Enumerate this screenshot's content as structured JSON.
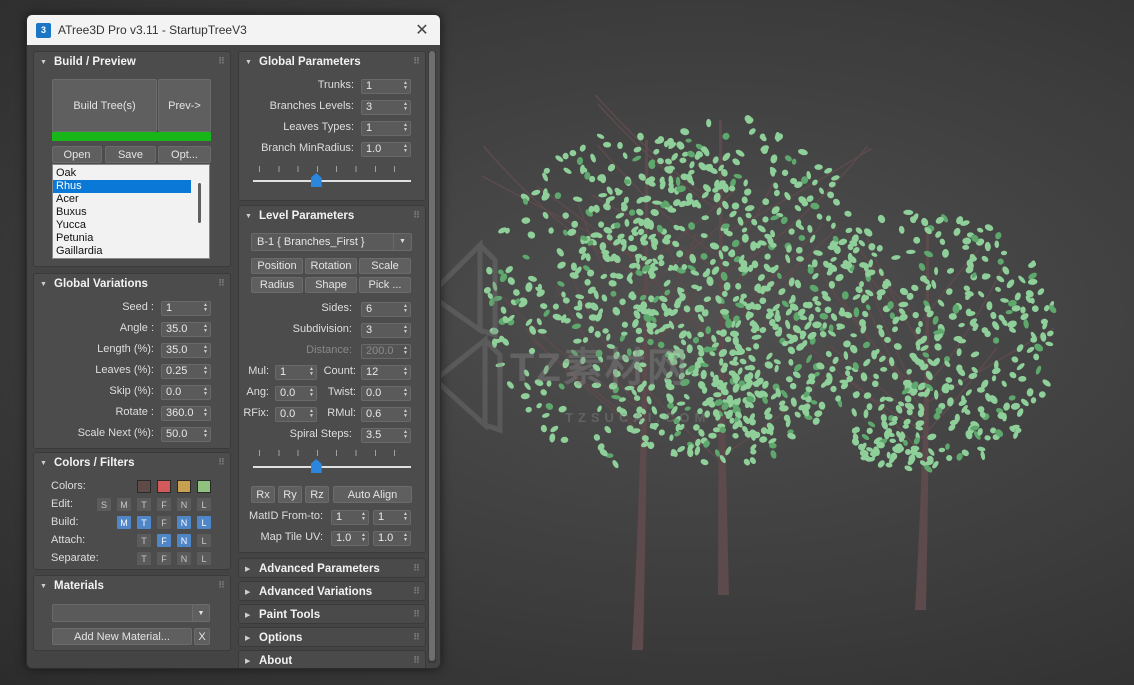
{
  "window": {
    "title": "ATree3D Pro v3.11 - StartupTreeV3",
    "icon_label": "3",
    "close_glyph": "✕"
  },
  "build_preview": {
    "title": "Build / Preview",
    "build_button": "Build Tree(s)",
    "preview_button": "Prev->",
    "progress": 1.0,
    "progress_color": "#19b619",
    "open_button": "Open",
    "save_button": "Save",
    "options_button": "Opt...",
    "tree_list": [
      "Oak",
      "Rhus",
      "Acer",
      "Buxus",
      "Yucca",
      "Petunia",
      "Gaillardia"
    ],
    "selected": "Rhus"
  },
  "global_variations": {
    "title": "Global Variations",
    "fields": [
      {
        "label": "Seed :",
        "value": "1"
      },
      {
        "label": "Angle :",
        "value": "35.0"
      },
      {
        "label": "Length (%):",
        "value": "35.0"
      },
      {
        "label": "Leaves (%):",
        "value": "0.25"
      },
      {
        "label": "Skip (%):",
        "value": "0.0"
      },
      {
        "label": "Rotate :",
        "value": "360.0"
      },
      {
        "label": "Scale Next (%):",
        "value": "50.0"
      }
    ]
  },
  "colors_filters": {
    "title": "Colors / Filters",
    "colors_label": "Colors:",
    "swatches": [
      "#5e4a47",
      "#d35a5a",
      "#c8a052",
      "#8fc27e"
    ],
    "rows": [
      {
        "label": "Edit:",
        "toggles": [
          {
            "t": "S",
            "on": false
          },
          {
            "t": "M",
            "on": false
          },
          {
            "t": "T",
            "on": false
          },
          {
            "t": "F",
            "on": false
          },
          {
            "t": "N",
            "on": false
          },
          {
            "t": "L",
            "on": false
          }
        ]
      },
      {
        "label": "Build:",
        "toggles": [
          {
            "t": "M",
            "on": true
          },
          {
            "t": "T",
            "on": true
          },
          {
            "t": "F",
            "on": false
          },
          {
            "t": "N",
            "on": true
          },
          {
            "t": "L",
            "on": true
          }
        ]
      },
      {
        "label": "Attach:",
        "toggles": [
          {
            "t": "T",
            "on": false
          },
          {
            "t": "F",
            "on": true
          },
          {
            "t": "N",
            "on": true
          },
          {
            "t": "L",
            "on": false
          }
        ]
      },
      {
        "label": "Separate:",
        "toggles": [
          {
            "t": "T",
            "on": false
          },
          {
            "t": "F",
            "on": false
          },
          {
            "t": "N",
            "on": false
          },
          {
            "t": "L",
            "on": false
          }
        ]
      }
    ]
  },
  "materials": {
    "title": "Materials",
    "selected": "",
    "add_button": "Add New Material...",
    "remove_button": "X"
  },
  "global_parameters": {
    "title": "Global Parameters",
    "fields": [
      {
        "label": "Trunks:",
        "value": "1"
      },
      {
        "label": "Branches Levels:",
        "value": "3"
      },
      {
        "label": "Leaves Types:",
        "value": "1"
      },
      {
        "label": "Branch MinRadius:",
        "value": "1.0"
      }
    ],
    "slider": 0.4
  },
  "level_parameters": {
    "title": "Level Parameters",
    "level_select": "B-1  { Branches_First }",
    "tabs_row1": [
      "Position",
      "Rotation",
      "Scale"
    ],
    "tabs_row2": [
      "Radius",
      "Shape",
      "Pick ..."
    ],
    "sides_label": "Sides:",
    "sides": "6",
    "subdivision_label": "Subdivision:",
    "subdivision": "3",
    "distance_label": "Distance:",
    "distance": "200.0",
    "mul_label": "Mul:",
    "mul": "1",
    "count_label": "Count:",
    "count": "12",
    "ang_label": "Ang:",
    "ang": "0.0",
    "twist_label": "Twist:",
    "twist": "0.0",
    "rfix_label": "RFix:",
    "rfix": "0.0",
    "rmul_label": "RMul:",
    "rmul": "0.6",
    "spiral_label": "Spiral Steps:",
    "spiral": "3.5",
    "slider": 0.4,
    "rx": "Rx",
    "ry": "Ry",
    "rz": "Rz",
    "auto_align": "Auto Align",
    "matid_label": "MatID From-to:",
    "matid_from": "1",
    "matid_to": "1",
    "maptile_label": "Map Tile UV:",
    "maptile_u": "1.0",
    "maptile_v": "1.0"
  },
  "collapsed_rollouts": [
    "Advanced Parameters",
    "Advanced Variations",
    "Paint Tools",
    "Options",
    "About"
  ],
  "viewport": {
    "watermark_main": "TZ素材网",
    "watermark_sub": "TZSUCAI.COM",
    "leaf_color": "#8fd09a",
    "trunk_color": "#5c4a4c"
  }
}
